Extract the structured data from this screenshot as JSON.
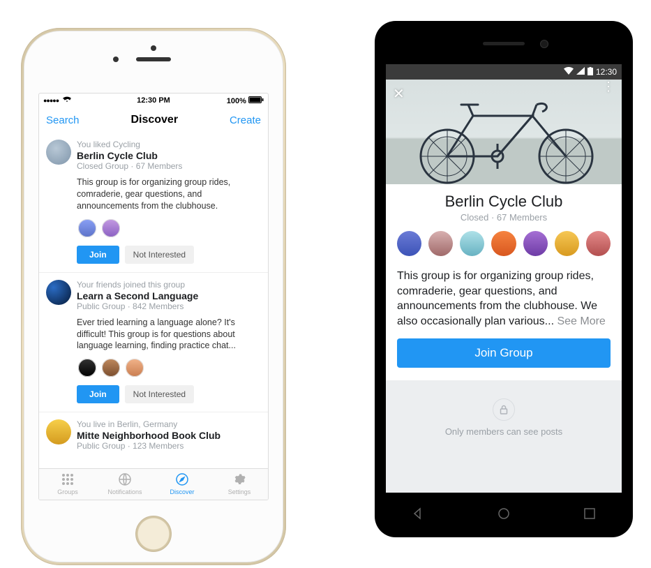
{
  "ios": {
    "statusbar": {
      "signal_dots": "●●●●●",
      "time": "12:30 PM",
      "battery": "100%"
    },
    "nav": {
      "left": "Search",
      "title": "Discover",
      "right": "Create"
    },
    "groups": [
      {
        "reason": "You liked Cycling",
        "name": "Berlin Cycle Club",
        "privacy": "Closed Group",
        "members": "67 Members",
        "desc": "This group is for organizing group rides, comraderie, gear questions, and announcements from the clubhouse.",
        "member_avatars": 2
      },
      {
        "reason": "Your friends joined this group",
        "name": "Learn a Second Language",
        "privacy": "Public Group",
        "members": "842 Members",
        "desc": "Ever tried learning a language alone? It's difficult! This group is for questions about language learning, finding practice chat...",
        "member_avatars": 3
      },
      {
        "reason": "You live in Berlin, Germany",
        "name": "Mitte Neighborhood Book Club",
        "privacy": "Public Group",
        "members": "123 Members",
        "desc": "",
        "member_avatars": 0
      }
    ],
    "buttons": {
      "join": "Join",
      "not_interested": "Not Interested"
    },
    "tabs": [
      {
        "icon": "grid-icon",
        "label": "Groups"
      },
      {
        "icon": "globe-icon",
        "label": "Notifications"
      },
      {
        "icon": "compass-icon",
        "label": "Discover"
      },
      {
        "icon": "gear-icon",
        "label": "Settings"
      }
    ],
    "active_tab": 2
  },
  "android": {
    "statusbar": {
      "time": "12:30"
    },
    "title": "Berlin Cycle Club",
    "privacy": "Closed",
    "members": "67 Members",
    "member_avatars": 7,
    "desc": "This group is for organizing group rides, comraderie, gear questions, and announcements from the clubhouse. We also occasionally plan various... ",
    "see_more": "See More",
    "join": "Join Group",
    "private_label": "Only members can see posts"
  }
}
